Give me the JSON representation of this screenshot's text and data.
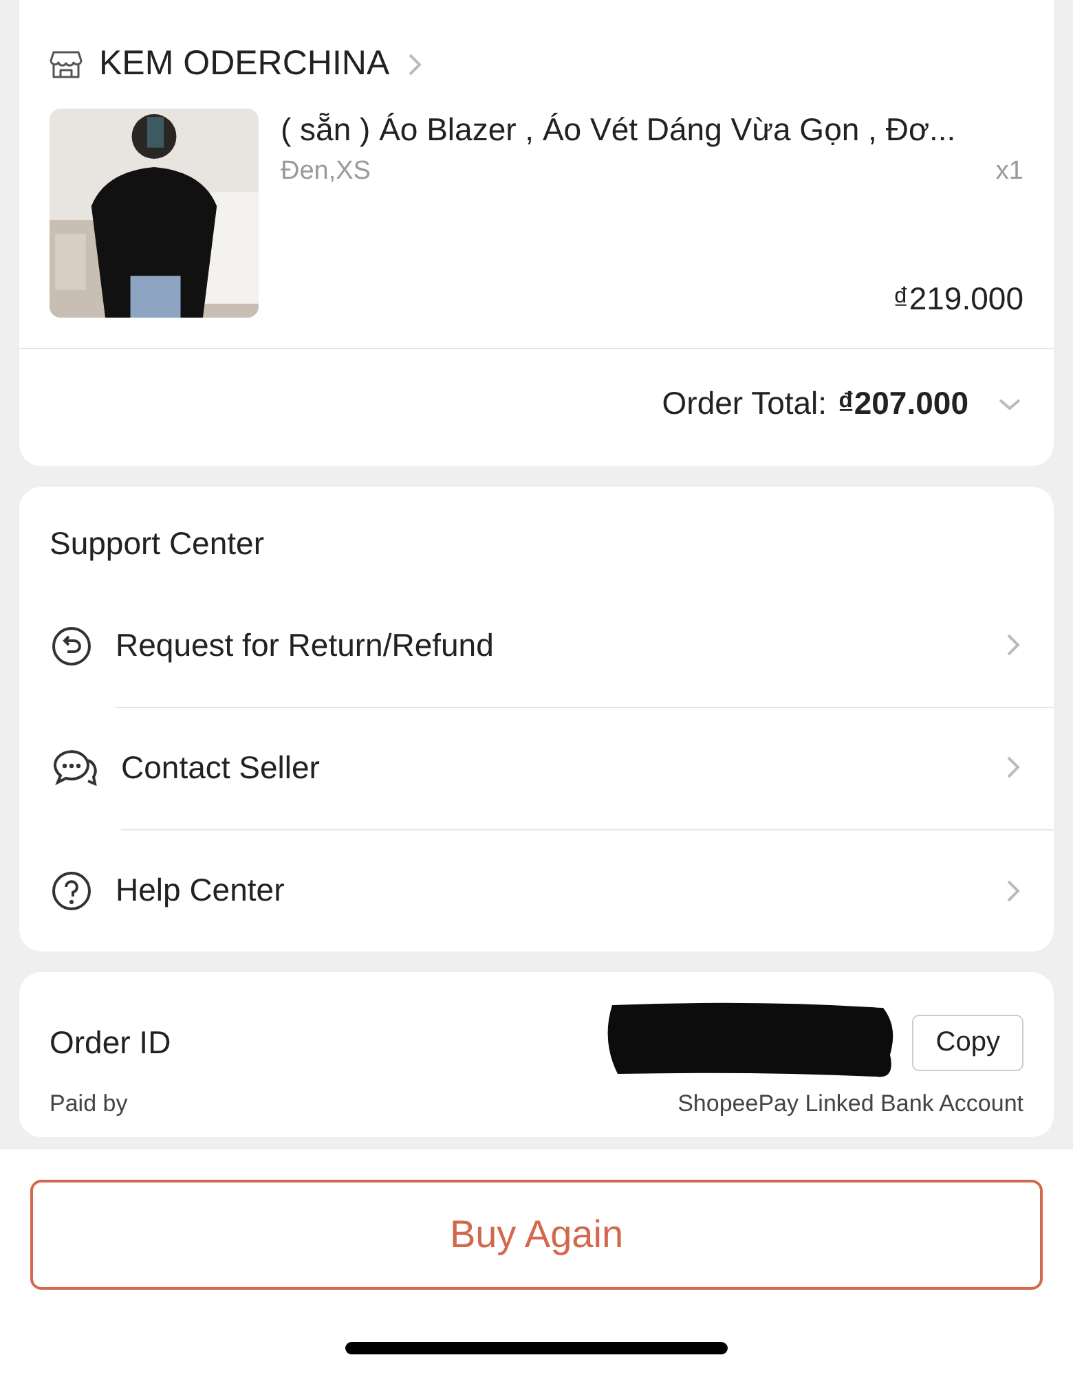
{
  "shop": {
    "name": "KEM ODERCHINA"
  },
  "product": {
    "title": "( sẵn ) Áo Blazer , Áo Vét Dáng Vừa Gọn , Đơ...",
    "variant": "Đen,XS",
    "quantity": "x1",
    "price": "₫219.000"
  },
  "order_total": {
    "label": "Order Total:",
    "value": "₫207.000",
    "expanded": false
  },
  "support": {
    "title": "Support Center",
    "items": [
      {
        "kind": "return",
        "label": "Request for Return/Refund"
      },
      {
        "kind": "chat",
        "label": "Contact Seller"
      },
      {
        "kind": "help",
        "label": "Help Center"
      }
    ]
  },
  "order_info": {
    "order_id_label": "Order ID",
    "order_id_redacted": true,
    "copy_button": "Copy",
    "paid_by_label": "Paid by",
    "paid_by_value": "ShopeePay Linked Bank Account"
  },
  "footer": {
    "button": "Buy Again"
  }
}
